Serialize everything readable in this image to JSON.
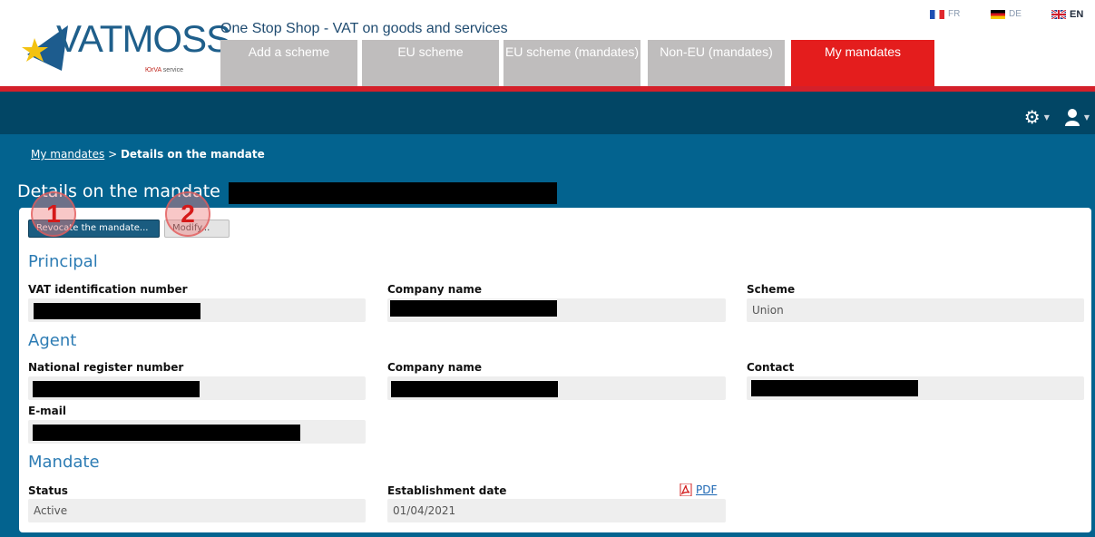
{
  "header": {
    "app_title": "One Stop Shop - VAT on goods and services",
    "logo_main": "VATMOSS",
    "logo_sub": "service",
    "logo_sub_brand": "ЮrVA"
  },
  "languages": [
    {
      "code": "FR",
      "active": false
    },
    {
      "code": "DE",
      "active": false
    },
    {
      "code": "EN",
      "active": true
    }
  ],
  "tabs": [
    {
      "label": "Add a scheme"
    },
    {
      "label": "EU scheme"
    },
    {
      "label": "EU scheme (mandates)"
    },
    {
      "label": "Non-EU (mandates)"
    },
    {
      "label": "My mandates",
      "active": true
    }
  ],
  "breadcrumb": {
    "parent": "My mandates",
    "separator": ">",
    "current": "Details on the mandate"
  },
  "page_title": "Details on the mandate",
  "buttons": {
    "revoke": "Revocate the mandate...",
    "modify": "Modify..."
  },
  "markers": [
    "1",
    "2"
  ],
  "principal": {
    "title": "Principal",
    "vat_label": "VAT identification number",
    "company_label": "Company name",
    "scheme_label": "Scheme",
    "scheme_value": "Union"
  },
  "agent": {
    "title": "Agent",
    "national_label": "National register number",
    "company_label": "Company name",
    "contact_label": "Contact",
    "email_label": "E-mail"
  },
  "mandate": {
    "title": "Mandate",
    "status_label": "Status",
    "status_value": "Active",
    "date_label": "Establishment date",
    "date_value": "01/04/2021",
    "pdf_label": "PDF"
  },
  "colors": {
    "tab_inactive": "#bfbdbd",
    "tab_active": "#e41d1d",
    "navbar": "#024665",
    "content": "#03638f",
    "section_title": "#2d7cb4"
  }
}
